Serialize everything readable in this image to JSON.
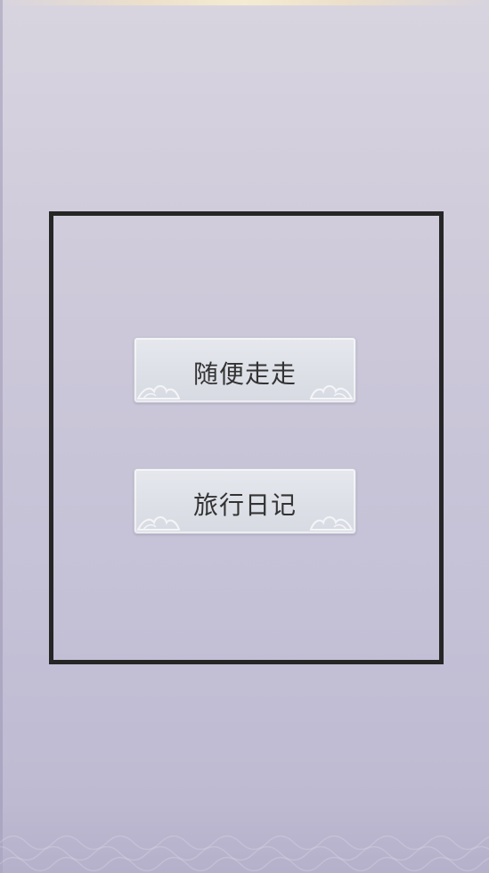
{
  "buttons": {
    "wander_label": "随便走走",
    "diary_label": "旅行日记"
  },
  "icons": {
    "button_corner_ornament": "cloud-ornament-icon"
  },
  "colors": {
    "background_top": "#d8d4df",
    "background_bottom": "#bcb8d0",
    "frame_border": "#262626",
    "button_fill": "#e0e3ea",
    "button_text": "#333333"
  }
}
